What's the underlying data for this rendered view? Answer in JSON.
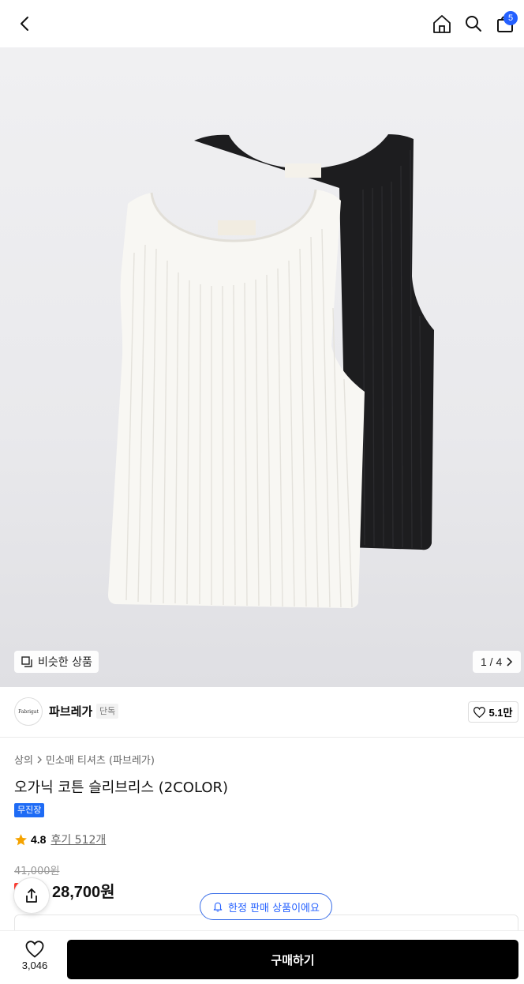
{
  "header": {
    "back_icon": "chevron-left-icon",
    "home_icon": "home-icon",
    "search_icon": "search-icon",
    "cart_icon": "shopping-bag-icon",
    "cart_count": "5"
  },
  "gallery": {
    "similar_label": "비슷한 상품",
    "page_indicator": "1 / 4",
    "product_logo_text": "Fabrigat"
  },
  "brand": {
    "logo_text": "Fabrigat",
    "name": "파브레가",
    "tag": "단독",
    "likes": "5.1만"
  },
  "product": {
    "breadcrumb_parent": "상의",
    "breadcrumb_child": "민소매 티셔츠 (파브레가)",
    "title": "오가닉 코튼 슬리브리스 (2COLOR)",
    "badge": "무진장",
    "rating": "4.8",
    "reviews": "후기 512개",
    "original_price": "41,000원",
    "sale_price": "28,700원"
  },
  "limited_notice": "한정 판매 상품이에요",
  "bottom": {
    "wish_count": "3,046",
    "buy_label": "구매하기"
  },
  "colors": {
    "accent_blue": "#2460ff",
    "badge_blue": "#1e6bf5",
    "star": "#f5a300",
    "sale_red": "#ff3b30"
  }
}
